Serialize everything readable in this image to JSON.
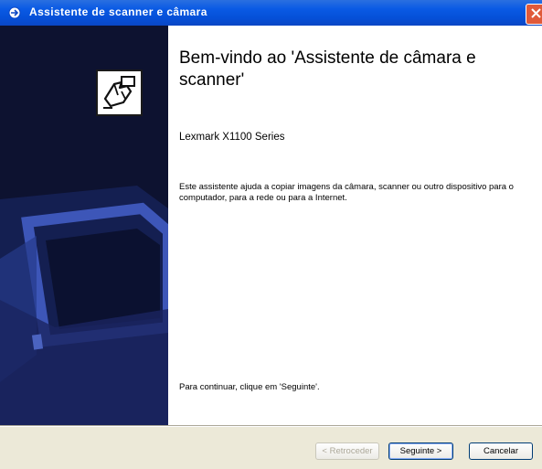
{
  "window": {
    "title": "Assistente de scanner e câmara"
  },
  "icons": {
    "title_icon": "scanner-camera-wizard-icon",
    "close": "close-icon",
    "wizard_logo": "hand-camera-icon"
  },
  "content": {
    "heading": "Bem-vindo ao 'Assistente de câmara e scanner'",
    "device_name": "Lexmark X1100 Series",
    "description": "Este assistente ajuda a copiar imagens da câmara, scanner ou outro dispositivo para o computador, para a rede ou para a Internet.",
    "continue_hint": "Para continuar, clique em 'Seguinte'."
  },
  "buttons": {
    "back": "< Retroceder",
    "next": "Seguinte >",
    "cancel": "Cancelar"
  },
  "colors": {
    "titlebar": "#0550d8",
    "left_panel": "#0d1230",
    "dialog_bg": "#ece9d8"
  }
}
